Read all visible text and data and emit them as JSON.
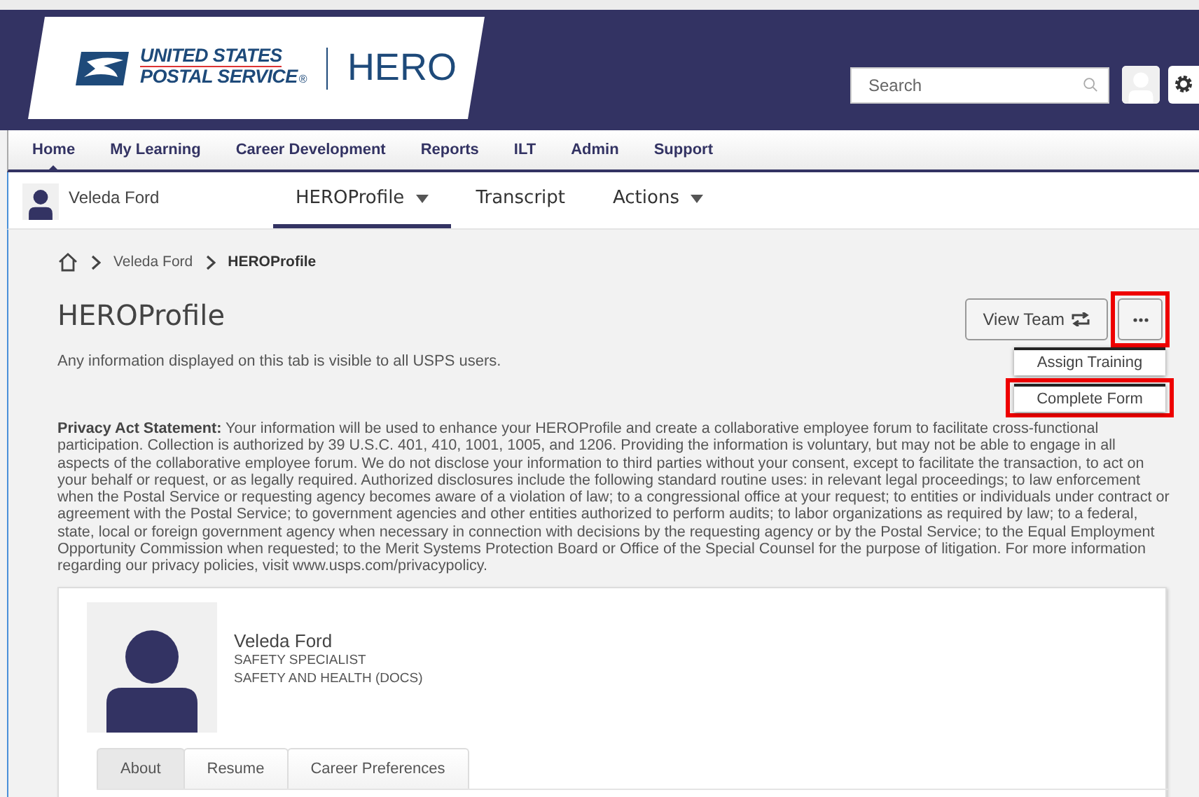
{
  "header": {
    "logo": {
      "line1": "UNITED STATES",
      "line2": "POSTAL SERVICE",
      "mark": "®",
      "product": "HERO"
    },
    "search": {
      "placeholder": "Search"
    }
  },
  "nav": {
    "items": [
      {
        "label": "Home",
        "selected": true
      },
      {
        "label": "My Learning",
        "selected": false
      },
      {
        "label": "Career Development",
        "selected": false
      },
      {
        "label": "Reports",
        "selected": false
      },
      {
        "label": "ILT",
        "selected": false
      },
      {
        "label": "Admin",
        "selected": false
      },
      {
        "label": "Support",
        "selected": false
      }
    ]
  },
  "profile_bar": {
    "user_name": "Veleda Ford",
    "tabs": [
      {
        "label": "HEROProfile",
        "selected": true,
        "dropdown": true
      },
      {
        "label": "Transcript",
        "selected": false,
        "dropdown": false
      },
      {
        "label": "Actions",
        "selected": false,
        "dropdown": true
      }
    ]
  },
  "breadcrumb": [
    "Veleda Ford",
    "HEROProfile"
  ],
  "title": "HEROProfile",
  "actions": {
    "view_team": "View Team",
    "more_highlighted": true,
    "menu": [
      {
        "label": "Assign Training",
        "highlighted": false
      },
      {
        "label": "Complete Form",
        "highlighted": true
      }
    ]
  },
  "notice": "Any information displayed on this tab is visible to all USPS users.",
  "privacy": "**Privacy Act Statement:** Your information will be used to enhance your HEROProfile and create a collaborative employee forum to facilitate cross-functional participation. Collection is authorized by 39 U.S.C. 401, 410, 1001, 1005, and 1206. Providing the information is voluntary, but may not be able to engage in all aspects of the collaborative employee forum. We do not disclose your information to third parties without your consent, except to facilitate the transaction, to act on your behalf or request, or as legally required. Authorized disclosures include the following standard routine uses: in relevant legal proceedings; to law enforcement when the Postal Service or requesting agency becomes aware of a violation of law; to a congressional office at your request; to entities or individuals under contract or agreement with the Postal Service; to government agencies and other entities authorized to perform audits; to labor organizations as required by law; to a federal, state, local or foreign government agency when necessary in connection with decisions by the requesting agency or by the Postal Service; to the Equal Employment Opportunity Commission when requested; to the Merit Systems Protection Board or Office of the Special Counsel for the purpose of litigation. For more information regarding our privacy policies, visit www.usps.com/privacypolicy.",
  "card": {
    "name": "Veleda Ford",
    "job_title": "SAFETY SPECIALIST",
    "department": "SAFETY AND HEALTH (DOCS)",
    "tabs": [
      {
        "label": "About",
        "selected": true
      },
      {
        "label": "Resume",
        "selected": false
      },
      {
        "label": "Career Preferences",
        "selected": false
      }
    ]
  }
}
